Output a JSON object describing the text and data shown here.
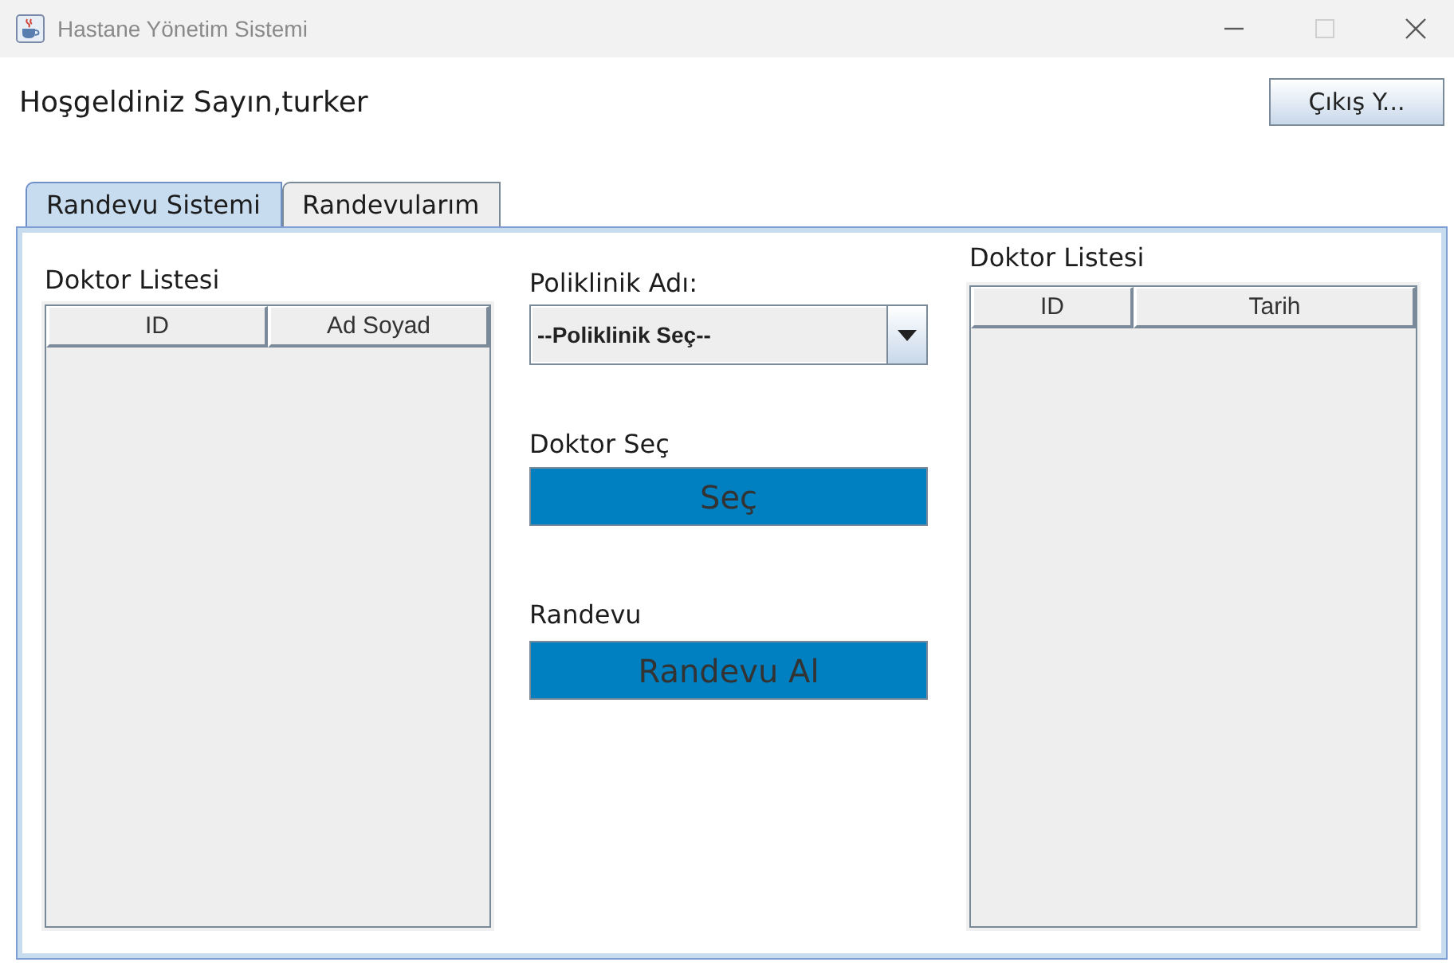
{
  "window": {
    "title": "Hastane Yönetim Sistemi",
    "controls": [
      {
        "kind": "minimize",
        "disabled": false
      },
      {
        "kind": "maximize",
        "disabled": true
      },
      {
        "kind": "close",
        "disabled": false
      }
    ]
  },
  "header": {
    "greeting": "Hoşgeldiniz Sayın,turker",
    "logout_button": "Çıkış Y..."
  },
  "tabs": [
    {
      "label": "Randevu Sistemi",
      "selected": true
    },
    {
      "label": "Randevularım",
      "selected": false
    }
  ],
  "doctor_panel": {
    "title": "Doktor Listesi",
    "table": {
      "columns": [
        "ID",
        "Ad Soyad"
      ]
    }
  },
  "clinic": {
    "label": "Poliklinik Adı:",
    "dropdown": {
      "value": "--Poliklinik Seç--"
    }
  },
  "doctor_select": {
    "label": "Doktor Seç",
    "button": "Seç"
  },
  "appointment": {
    "label": "Randevu",
    "button": "Randevu Al"
  },
  "appointment_panel": {
    "title": "Doktor Listesi",
    "table": {
      "columns": [
        "ID",
        "Tarih"
      ]
    }
  }
}
